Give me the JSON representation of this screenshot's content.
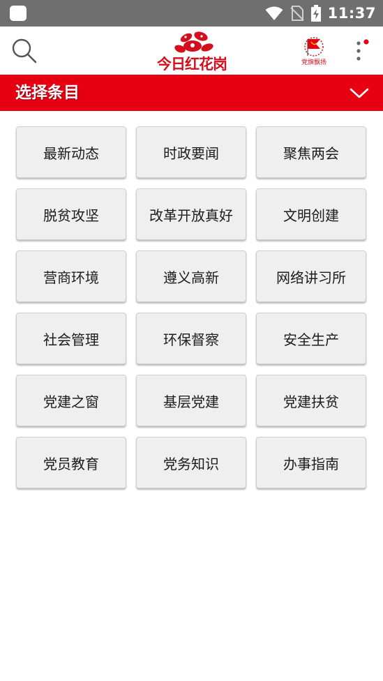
{
  "status_bar": {
    "time": "11:37",
    "icons": [
      "app-notification-icon",
      "wifi-icon",
      "no-sim-icon",
      "battery-charging-icon"
    ]
  },
  "header": {
    "logo_text": "今日红花岗",
    "badge_label": "党旗飘扬",
    "icons": [
      "search-icon",
      "flower-logo-icon",
      "party-flag-icon",
      "more-vertical-icon"
    ],
    "notification_dot_color": "#e60012"
  },
  "select_bar": {
    "title": "选择条目",
    "color": "#e60012",
    "icon": "chevron-down-icon"
  },
  "categories": [
    "最新动态",
    "时政要闻",
    "聚焦两会",
    "脱贫攻坚",
    "改革开放真好",
    "文明创建",
    "营商环境",
    "遵义高新",
    "网络讲习所",
    "社会管理",
    "环保督察",
    "安全生产",
    "党建之窗",
    "基层党建",
    "党建扶贫",
    "党员教育",
    "党务知识",
    "办事指南"
  ]
}
